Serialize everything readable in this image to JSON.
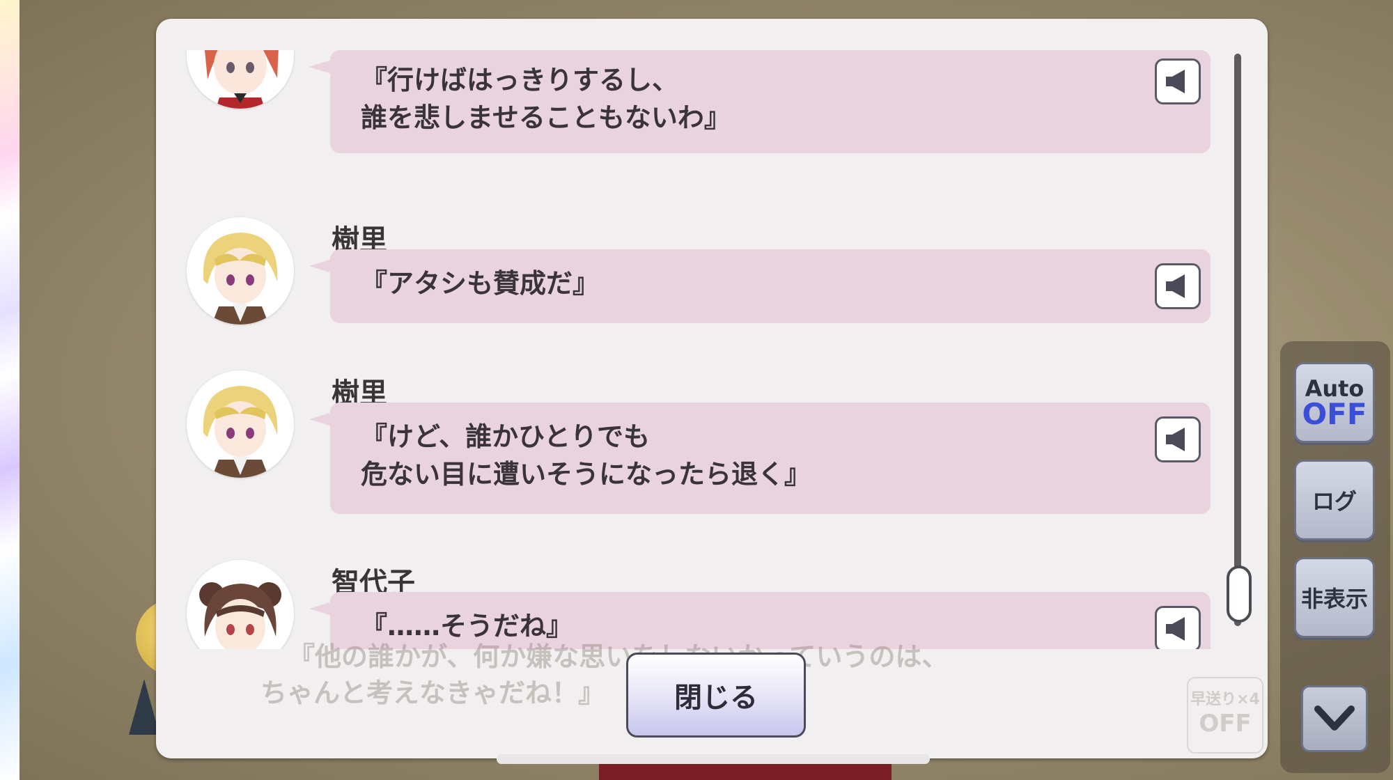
{
  "log": {
    "entries": [
      {
        "speaker": "",
        "avatar": "redhead-character-avatar",
        "lines": [
          "『行けばはっきりするし、",
          "誰を悲しませることもないわ』"
        ]
      },
      {
        "speaker": "樹里",
        "avatar": "blonde-character-avatar",
        "lines": [
          "『アタシも賛成だ』"
        ]
      },
      {
        "speaker": "樹里",
        "avatar": "blonde-character-avatar",
        "lines": [
          "『けど、誰かひとりでも",
          "危ない目に遭いそうになったら退く』"
        ]
      },
      {
        "speaker": "智代子",
        "avatar": "brunette-character-avatar",
        "lines": [
          "『……そうだね』"
        ]
      }
    ],
    "close_label": "閉じる",
    "behind_text": [
      "『他の誰かが、何か嫌な思いをしないかっていうのは、",
      "ちゃんと考えなきゃだね！』"
    ],
    "fast_forward": [
      "早送り×4",
      "OFF"
    ]
  },
  "side": {
    "auto_label": "Auto",
    "auto_state": "OFF",
    "log_label": "ログ",
    "hide_label": "非表示"
  },
  "colors": {
    "bubble": "#e8d3de",
    "modal": "#f1efef",
    "auto_off": "#3b4fd6"
  }
}
